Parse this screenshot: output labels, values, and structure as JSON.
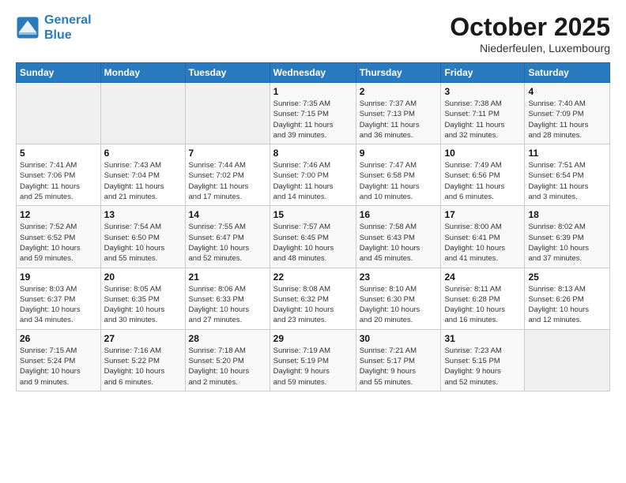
{
  "logo": {
    "line1": "General",
    "line2": "Blue"
  },
  "title": "October 2025",
  "subtitle": "Niederfeulen, Luxembourg",
  "weekdays": [
    "Sunday",
    "Monday",
    "Tuesday",
    "Wednesday",
    "Thursday",
    "Friday",
    "Saturday"
  ],
  "weeks": [
    [
      {
        "day": "",
        "info": ""
      },
      {
        "day": "",
        "info": ""
      },
      {
        "day": "",
        "info": ""
      },
      {
        "day": "1",
        "info": "Sunrise: 7:35 AM\nSunset: 7:15 PM\nDaylight: 11 hours\nand 39 minutes."
      },
      {
        "day": "2",
        "info": "Sunrise: 7:37 AM\nSunset: 7:13 PM\nDaylight: 11 hours\nand 36 minutes."
      },
      {
        "day": "3",
        "info": "Sunrise: 7:38 AM\nSunset: 7:11 PM\nDaylight: 11 hours\nand 32 minutes."
      },
      {
        "day": "4",
        "info": "Sunrise: 7:40 AM\nSunset: 7:09 PM\nDaylight: 11 hours\nand 28 minutes."
      }
    ],
    [
      {
        "day": "5",
        "info": "Sunrise: 7:41 AM\nSunset: 7:06 PM\nDaylight: 11 hours\nand 25 minutes."
      },
      {
        "day": "6",
        "info": "Sunrise: 7:43 AM\nSunset: 7:04 PM\nDaylight: 11 hours\nand 21 minutes."
      },
      {
        "day": "7",
        "info": "Sunrise: 7:44 AM\nSunset: 7:02 PM\nDaylight: 11 hours\nand 17 minutes."
      },
      {
        "day": "8",
        "info": "Sunrise: 7:46 AM\nSunset: 7:00 PM\nDaylight: 11 hours\nand 14 minutes."
      },
      {
        "day": "9",
        "info": "Sunrise: 7:47 AM\nSunset: 6:58 PM\nDaylight: 11 hours\nand 10 minutes."
      },
      {
        "day": "10",
        "info": "Sunrise: 7:49 AM\nSunset: 6:56 PM\nDaylight: 11 hours\nand 6 minutes."
      },
      {
        "day": "11",
        "info": "Sunrise: 7:51 AM\nSunset: 6:54 PM\nDaylight: 11 hours\nand 3 minutes."
      }
    ],
    [
      {
        "day": "12",
        "info": "Sunrise: 7:52 AM\nSunset: 6:52 PM\nDaylight: 10 hours\nand 59 minutes."
      },
      {
        "day": "13",
        "info": "Sunrise: 7:54 AM\nSunset: 6:50 PM\nDaylight: 10 hours\nand 55 minutes."
      },
      {
        "day": "14",
        "info": "Sunrise: 7:55 AM\nSunset: 6:47 PM\nDaylight: 10 hours\nand 52 minutes."
      },
      {
        "day": "15",
        "info": "Sunrise: 7:57 AM\nSunset: 6:45 PM\nDaylight: 10 hours\nand 48 minutes."
      },
      {
        "day": "16",
        "info": "Sunrise: 7:58 AM\nSunset: 6:43 PM\nDaylight: 10 hours\nand 45 minutes."
      },
      {
        "day": "17",
        "info": "Sunrise: 8:00 AM\nSunset: 6:41 PM\nDaylight: 10 hours\nand 41 minutes."
      },
      {
        "day": "18",
        "info": "Sunrise: 8:02 AM\nSunset: 6:39 PM\nDaylight: 10 hours\nand 37 minutes."
      }
    ],
    [
      {
        "day": "19",
        "info": "Sunrise: 8:03 AM\nSunset: 6:37 PM\nDaylight: 10 hours\nand 34 minutes."
      },
      {
        "day": "20",
        "info": "Sunrise: 8:05 AM\nSunset: 6:35 PM\nDaylight: 10 hours\nand 30 minutes."
      },
      {
        "day": "21",
        "info": "Sunrise: 8:06 AM\nSunset: 6:33 PM\nDaylight: 10 hours\nand 27 minutes."
      },
      {
        "day": "22",
        "info": "Sunrise: 8:08 AM\nSunset: 6:32 PM\nDaylight: 10 hours\nand 23 minutes."
      },
      {
        "day": "23",
        "info": "Sunrise: 8:10 AM\nSunset: 6:30 PM\nDaylight: 10 hours\nand 20 minutes."
      },
      {
        "day": "24",
        "info": "Sunrise: 8:11 AM\nSunset: 6:28 PM\nDaylight: 10 hours\nand 16 minutes."
      },
      {
        "day": "25",
        "info": "Sunrise: 8:13 AM\nSunset: 6:26 PM\nDaylight: 10 hours\nand 12 minutes."
      }
    ],
    [
      {
        "day": "26",
        "info": "Sunrise: 7:15 AM\nSunset: 5:24 PM\nDaylight: 10 hours\nand 9 minutes."
      },
      {
        "day": "27",
        "info": "Sunrise: 7:16 AM\nSunset: 5:22 PM\nDaylight: 10 hours\nand 6 minutes."
      },
      {
        "day": "28",
        "info": "Sunrise: 7:18 AM\nSunset: 5:20 PM\nDaylight: 10 hours\nand 2 minutes."
      },
      {
        "day": "29",
        "info": "Sunrise: 7:19 AM\nSunset: 5:19 PM\nDaylight: 9 hours\nand 59 minutes."
      },
      {
        "day": "30",
        "info": "Sunrise: 7:21 AM\nSunset: 5:17 PM\nDaylight: 9 hours\nand 55 minutes."
      },
      {
        "day": "31",
        "info": "Sunrise: 7:23 AM\nSunset: 5:15 PM\nDaylight: 9 hours\nand 52 minutes."
      },
      {
        "day": "",
        "info": ""
      }
    ]
  ]
}
